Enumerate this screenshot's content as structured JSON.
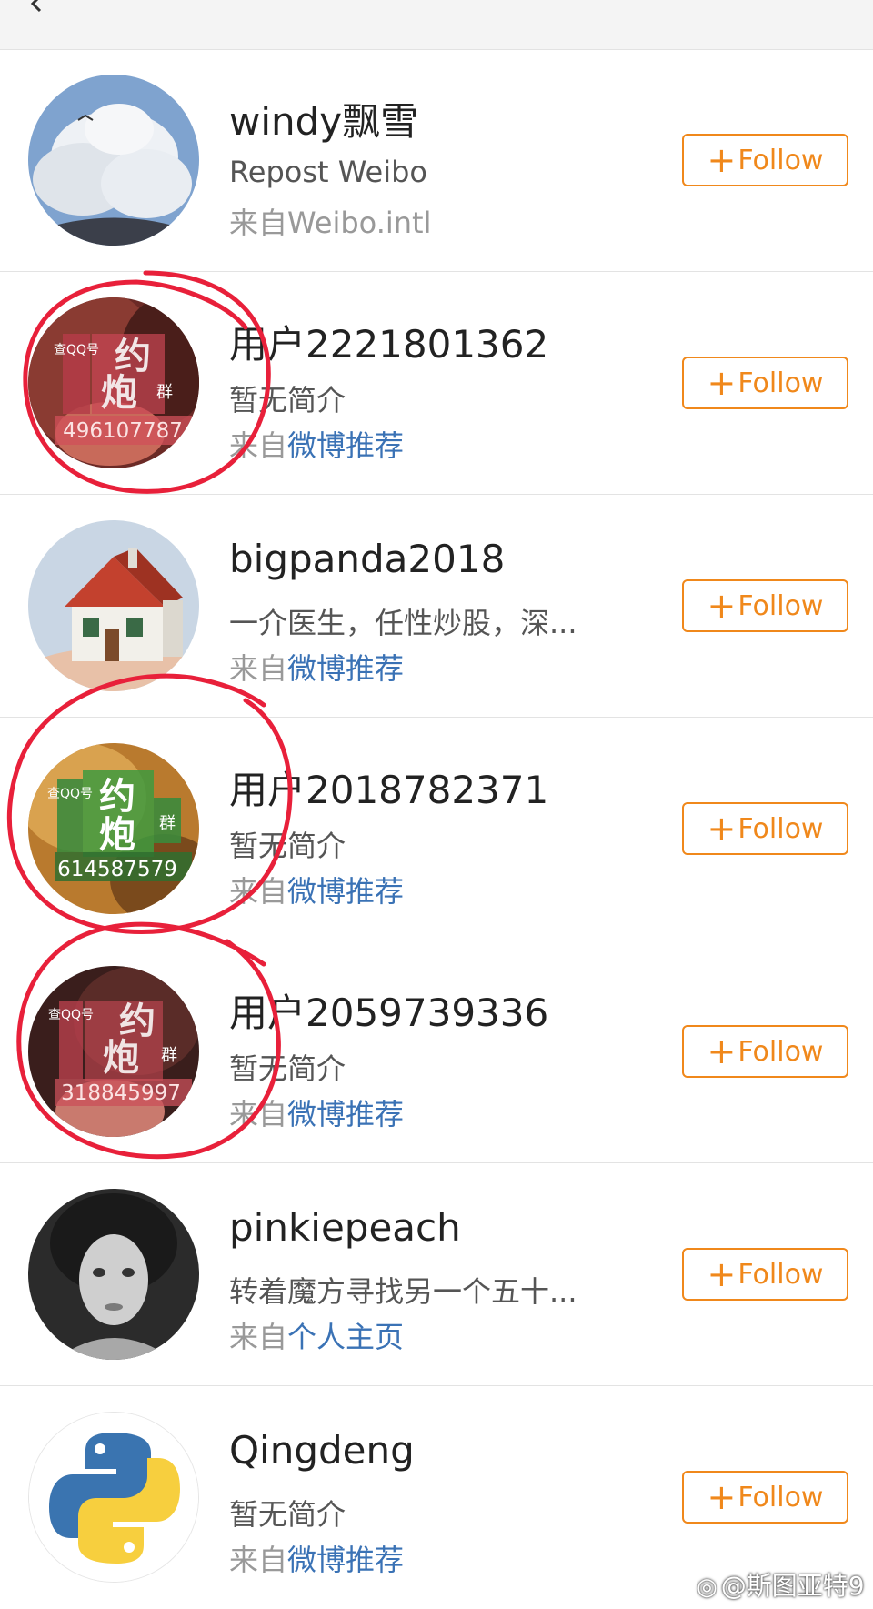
{
  "watermark": {
    "text": "@斯图亚特9"
  },
  "users": [
    {
      "name": "windy飘雪",
      "bio": "Repost Weibo",
      "source_prefix": "来自",
      "source_link": "Weibo.intl",
      "follow_label": "Follow"
    },
    {
      "name": "用户2221801362",
      "bio": "暂无简介",
      "source_prefix": "来自",
      "source_link": "微博推荐",
      "follow_label": "Follow",
      "avatar_text": {
        "t1": "约",
        "t2": "炮",
        "t3": "群",
        "side": "查QQ号",
        "number": "496107787"
      }
    },
    {
      "name": "bigpanda2018",
      "bio": "一介医生，任性炒股，深...",
      "source_prefix": "来自",
      "source_link": "微博推荐",
      "follow_label": "Follow"
    },
    {
      "name": "用户2018782371",
      "bio": "暂无简介",
      "source_prefix": "来自",
      "source_link": "微博推荐",
      "follow_label": "Follow",
      "avatar_text": {
        "t1": "约",
        "t2": "炮",
        "t3": "群",
        "side": "查QQ号",
        "number": "614587579"
      }
    },
    {
      "name": "用户2059739336",
      "bio": "暂无简介",
      "source_prefix": "来自",
      "source_link": "微博推荐",
      "follow_label": "Follow",
      "avatar_text": {
        "t1": "约",
        "t2": "炮",
        "t3": "群",
        "side": "查QQ号",
        "number": "318845997"
      }
    },
    {
      "name": "pinkiepeach",
      "bio": "转着魔方寻找另一个五十...",
      "source_prefix": "来自",
      "source_link": "个人主页",
      "follow_label": "Follow"
    },
    {
      "name": "Qingdeng",
      "bio": "暂无简介",
      "source_prefix": "来自",
      "source_link": "微博推荐",
      "follow_label": "Follow"
    }
  ],
  "colors": {
    "follow": "#f0881b",
    "link": "#3a72b5",
    "annotation": "#e8203a"
  }
}
